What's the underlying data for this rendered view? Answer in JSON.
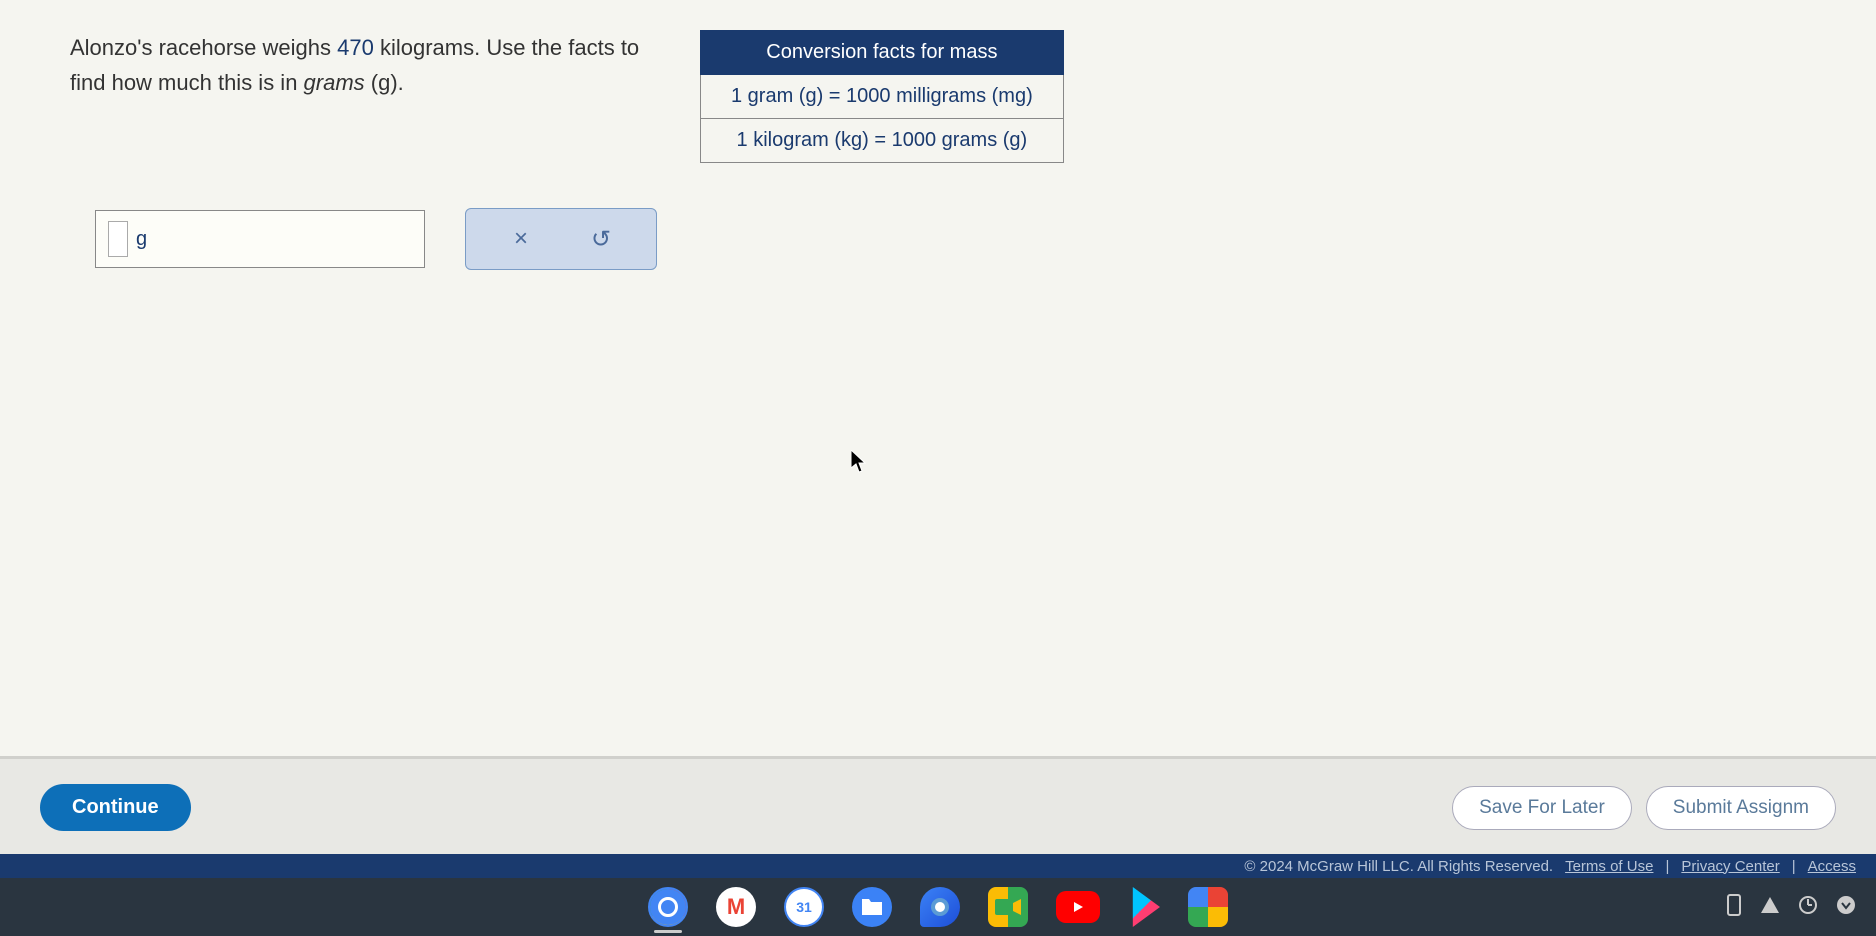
{
  "question": {
    "part1": "Alonzo's racehorse weighs ",
    "weight": "470",
    "part2": " kilograms. Use the facts to find how much this is in ",
    "unit_italic": "grams",
    "part3": " (g)."
  },
  "conversion_table": {
    "header": "Conversion facts for mass",
    "rows": [
      "1 gram (g) = 1000 milligrams (mg)",
      "1 kilogram (kg) = 1000 grams (g)"
    ]
  },
  "answer": {
    "value": "",
    "unit": "g"
  },
  "tools": {
    "clear": "×",
    "reset": "↺"
  },
  "buttons": {
    "continue": "Continue",
    "save": "Save For Later",
    "submit": "Submit Assignm"
  },
  "footer": {
    "copyright": "© 2024 McGraw Hill LLC. All Rights Reserved.",
    "terms": "Terms of Use",
    "privacy": "Privacy Center",
    "access": "Access"
  },
  "taskbar": {
    "gmail": "M",
    "calendar": "31",
    "files": "📁",
    "chat": "💬",
    "youtube": "▸",
    "phone": "📱",
    "warn": "▲",
    "clock": "◔",
    "settings": "⚙"
  }
}
